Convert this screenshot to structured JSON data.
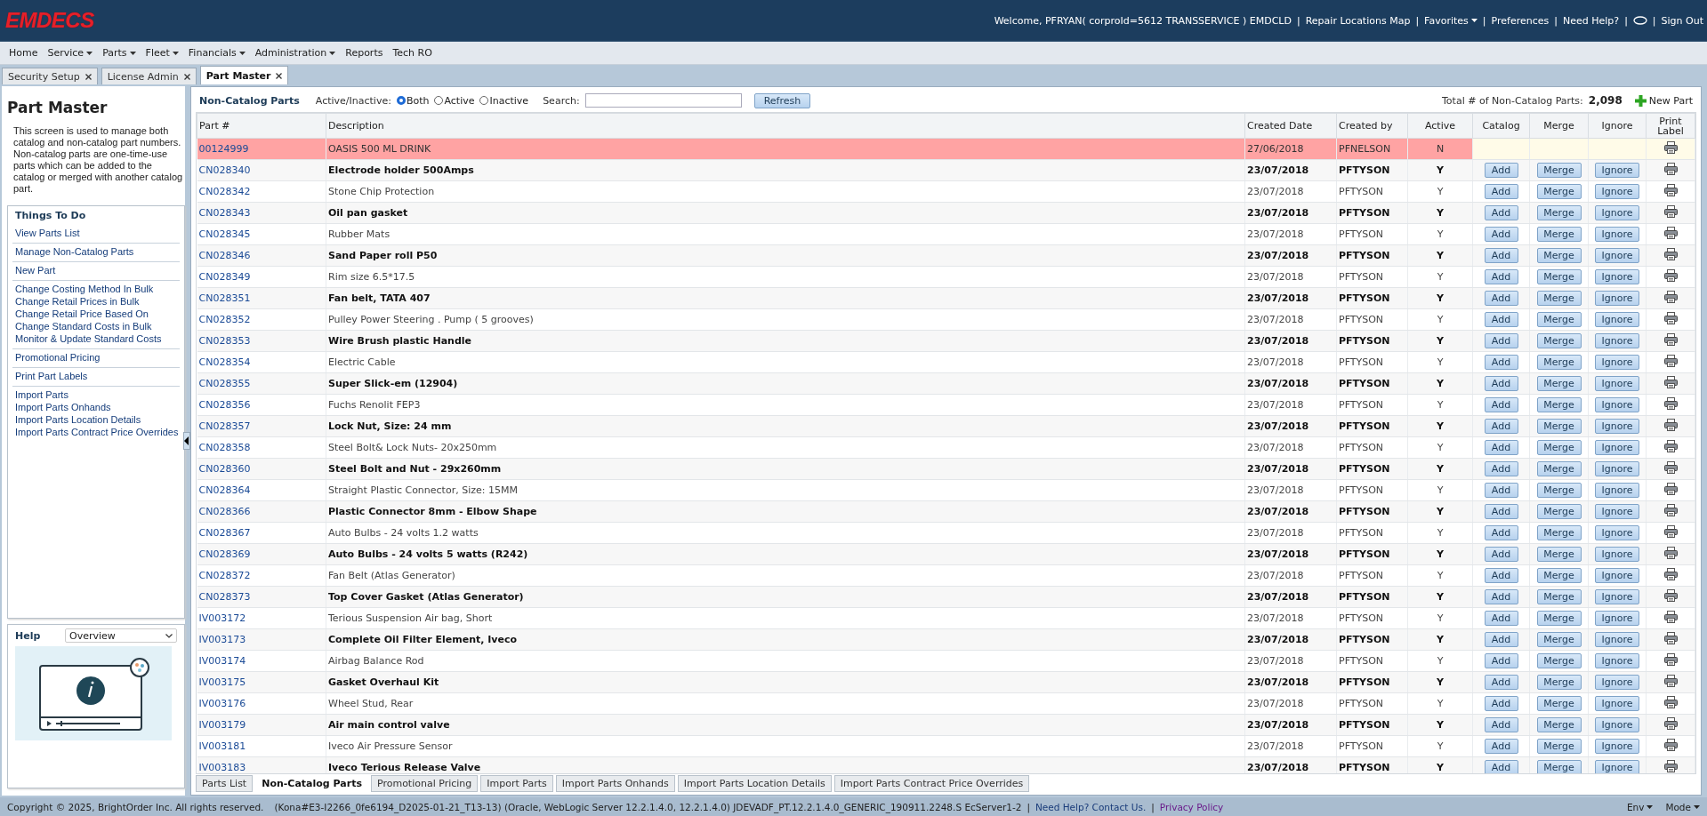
{
  "header": {
    "logo": "EMDECS",
    "items": [
      {
        "kind": "text",
        "text": "Welcome, PFRYAN( corproId=5612  TRANSSERVICE ) EMDCLD"
      },
      {
        "kind": "sep",
        "text": "|"
      },
      {
        "kind": "link",
        "text": "Repair Locations Map"
      },
      {
        "kind": "sep",
        "text": "|"
      },
      {
        "kind": "menu",
        "text": "Favorites"
      },
      {
        "kind": "sep",
        "text": "|"
      },
      {
        "kind": "link",
        "text": "Preferences"
      },
      {
        "kind": "sep",
        "text": "|"
      },
      {
        "kind": "link",
        "text": "Need Help?"
      },
      {
        "kind": "sep",
        "text": "|"
      },
      {
        "kind": "icon"
      },
      {
        "kind": "sep",
        "text": "|"
      },
      {
        "kind": "link",
        "text": "Sign Out"
      }
    ]
  },
  "menu": [
    {
      "label": "Home",
      "dropdown": false
    },
    {
      "label": "Service",
      "dropdown": true
    },
    {
      "label": "Parts",
      "dropdown": true
    },
    {
      "label": "Fleet",
      "dropdown": true
    },
    {
      "label": "Financials",
      "dropdown": true
    },
    {
      "label": "Administration",
      "dropdown": true
    },
    {
      "label": "Reports",
      "dropdown": false
    },
    {
      "label": "Tech RO",
      "dropdown": false
    }
  ],
  "tabs": [
    {
      "label": "Security Setup",
      "selected": false
    },
    {
      "label": "License Admin",
      "selected": false
    },
    {
      "label": "Part Master",
      "selected": true
    }
  ],
  "sidebar": {
    "title": "Part Master",
    "description": "This screen is used to manage both catalog and non-catalog part numbers. Non-catalog parts are one-time-use parts which can be added to the catalog or merged with another catalog part.",
    "todo_title": "Things To Do",
    "groups": [
      [
        "View Parts List"
      ],
      [
        "Manage Non-Catalog Parts"
      ],
      [
        "New Part"
      ],
      [
        "Change Costing Method In Bulk",
        "Change Retail Prices in Bulk",
        "Change Retail Price Based On",
        "Change Standard Costs in Bulk",
        "Monitor & Update Standard Costs"
      ],
      [
        "Promotional Pricing"
      ],
      [
        "Print Part Labels"
      ],
      [
        "Import Parts",
        "Import Parts Onhands",
        "Import Parts Location Details",
        "Import Parts Contract Price Overrides"
      ]
    ],
    "help": {
      "title": "Help",
      "select": "Overview"
    }
  },
  "toolbar": {
    "title": "Non-Catalog Parts",
    "filter_label": "Active/Inactive:",
    "radios": [
      {
        "label": "Both",
        "selected": true
      },
      {
        "label": "Active",
        "selected": false
      },
      {
        "label": "Inactive",
        "selected": false
      }
    ],
    "search_label": "Search:",
    "refresh": "Refresh",
    "total_label": "Total # of Non-Catalog Parts:",
    "total_value": "2,098",
    "new_part": "New Part"
  },
  "table": {
    "columns": [
      "Part #",
      "Description",
      "Created Date",
      "Created by",
      "Active",
      "Catalog",
      "Merge",
      "Ignore",
      "Print Label"
    ],
    "rows": [
      {
        "part": "00124999",
        "description": "OASIS 500 ML DRINK",
        "created": "27/06/2018",
        "by": "PFNELSON",
        "active": "N",
        "flagged": true
      },
      {
        "part": "CN028340",
        "description": "Electrode holder 500Amps",
        "created": "23/07/2018",
        "by": "PFTYSON",
        "active": "Y",
        "flagged": false,
        "catalog": "Add",
        "merge": "Merge",
        "ignore": "Ignore"
      },
      {
        "part": "CN028342",
        "description": "Stone Chip Protection",
        "created": "23/07/2018",
        "by": "PFTYSON",
        "active": "Y",
        "flagged": false,
        "catalog": "Add",
        "merge": "Merge",
        "ignore": "Ignore"
      },
      {
        "part": "CN028343",
        "description": "Oil pan gasket",
        "created": "23/07/2018",
        "by": "PFTYSON",
        "active": "Y",
        "flagged": false,
        "catalog": "Add",
        "merge": "Merge",
        "ignore": "Ignore"
      },
      {
        "part": "CN028345",
        "description": "Rubber Mats",
        "created": "23/07/2018",
        "by": "PFTYSON",
        "active": "Y",
        "flagged": false,
        "catalog": "Add",
        "merge": "Merge",
        "ignore": "Ignore"
      },
      {
        "part": "CN028346",
        "description": "Sand Paper roll P50",
        "created": "23/07/2018",
        "by": "PFTYSON",
        "active": "Y",
        "flagged": false,
        "catalog": "Add",
        "merge": "Merge",
        "ignore": "Ignore"
      },
      {
        "part": "CN028349",
        "description": "Rim size 6.5*17.5",
        "created": "23/07/2018",
        "by": "PFTYSON",
        "active": "Y",
        "flagged": false,
        "catalog": "Add",
        "merge": "Merge",
        "ignore": "Ignore"
      },
      {
        "part": "CN028351",
        "description": "Fan belt, TATA 407",
        "created": "23/07/2018",
        "by": "PFTYSON",
        "active": "Y",
        "flagged": false,
        "catalog": "Add",
        "merge": "Merge",
        "ignore": "Ignore"
      },
      {
        "part": "CN028352",
        "description": "Pulley Power Steering . Pump ( 5 grooves)",
        "created": "23/07/2018",
        "by": "PFTYSON",
        "active": "Y",
        "flagged": false,
        "catalog": "Add",
        "merge": "Merge",
        "ignore": "Ignore"
      },
      {
        "part": "CN028353",
        "description": "Wire Brush plastic Handle",
        "created": "23/07/2018",
        "by": "PFTYSON",
        "active": "Y",
        "flagged": false,
        "catalog": "Add",
        "merge": "Merge",
        "ignore": "Ignore"
      },
      {
        "part": "CN028354",
        "description": "Electric Cable",
        "created": "23/07/2018",
        "by": "PFTYSON",
        "active": "Y",
        "flagged": false,
        "catalog": "Add",
        "merge": "Merge",
        "ignore": "Ignore"
      },
      {
        "part": "CN028355",
        "description": "Super Slick-em (12904)",
        "created": "23/07/2018",
        "by": "PFTYSON",
        "active": "Y",
        "flagged": false,
        "catalog": "Add",
        "merge": "Merge",
        "ignore": "Ignore"
      },
      {
        "part": "CN028356",
        "description": "Fuchs Renolit FEP3",
        "created": "23/07/2018",
        "by": "PFTYSON",
        "active": "Y",
        "flagged": false,
        "catalog": "Add",
        "merge": "Merge",
        "ignore": "Ignore"
      },
      {
        "part": "CN028357",
        "description": "Lock Nut, Size: 24 mm",
        "created": "23/07/2018",
        "by": "PFTYSON",
        "active": "Y",
        "flagged": false,
        "catalog": "Add",
        "merge": "Merge",
        "ignore": "Ignore"
      },
      {
        "part": "CN028358",
        "description": "Steel Bolt& Lock Nuts- 20x250mm",
        "created": "23/07/2018",
        "by": "PFTYSON",
        "active": "Y",
        "flagged": false,
        "catalog": "Add",
        "merge": "Merge",
        "ignore": "Ignore"
      },
      {
        "part": "CN028360",
        "description": "Steel Bolt and Nut - 29x260mm",
        "created": "23/07/2018",
        "by": "PFTYSON",
        "active": "Y",
        "flagged": false,
        "catalog": "Add",
        "merge": "Merge",
        "ignore": "Ignore"
      },
      {
        "part": "CN028364",
        "description": "Straight Plastic Connector, Size: 15MM",
        "created": "23/07/2018",
        "by": "PFTYSON",
        "active": "Y",
        "flagged": false,
        "catalog": "Add",
        "merge": "Merge",
        "ignore": "Ignore"
      },
      {
        "part": "CN028366",
        "description": "Plastic Connector 8mm - Elbow Shape",
        "created": "23/07/2018",
        "by": "PFTYSON",
        "active": "Y",
        "flagged": false,
        "catalog": "Add",
        "merge": "Merge",
        "ignore": "Ignore"
      },
      {
        "part": "CN028367",
        "description": "Auto Bulbs - 24 volts 1.2 watts",
        "created": "23/07/2018",
        "by": "PFTYSON",
        "active": "Y",
        "flagged": false,
        "catalog": "Add",
        "merge": "Merge",
        "ignore": "Ignore"
      },
      {
        "part": "CN028369",
        "description": "Auto Bulbs - 24 volts 5 watts (R242)",
        "created": "23/07/2018",
        "by": "PFTYSON",
        "active": "Y",
        "flagged": false,
        "catalog": "Add",
        "merge": "Merge",
        "ignore": "Ignore"
      },
      {
        "part": "CN028372",
        "description": "Fan Belt (Atlas Generator)",
        "created": "23/07/2018",
        "by": "PFTYSON",
        "active": "Y",
        "flagged": false,
        "catalog": "Add",
        "merge": "Merge",
        "ignore": "Ignore"
      },
      {
        "part": "CN028373",
        "description": "Top Cover Gasket (Atlas Generator)",
        "created": "23/07/2018",
        "by": "PFTYSON",
        "active": "Y",
        "flagged": false,
        "catalog": "Add",
        "merge": "Merge",
        "ignore": "Ignore"
      },
      {
        "part": "IV003172",
        "description": "Terious Suspension Air bag, Short",
        "created": "23/07/2018",
        "by": "PFTYSON",
        "active": "Y",
        "flagged": false,
        "catalog": "Add",
        "merge": "Merge",
        "ignore": "Ignore"
      },
      {
        "part": "IV003173",
        "description": "Complete Oil Filter Element, Iveco",
        "created": "23/07/2018",
        "by": "PFTYSON",
        "active": "Y",
        "flagged": false,
        "catalog": "Add",
        "merge": "Merge",
        "ignore": "Ignore"
      },
      {
        "part": "IV003174",
        "description": "Airbag Balance Rod",
        "created": "23/07/2018",
        "by": "PFTYSON",
        "active": "Y",
        "flagged": false,
        "catalog": "Add",
        "merge": "Merge",
        "ignore": "Ignore"
      },
      {
        "part": "IV003175",
        "description": "Gasket Overhaul Kit",
        "created": "23/07/2018",
        "by": "PFTYSON",
        "active": "Y",
        "flagged": false,
        "catalog": "Add",
        "merge": "Merge",
        "ignore": "Ignore"
      },
      {
        "part": "IV003176",
        "description": "Wheel Stud, Rear",
        "created": "23/07/2018",
        "by": "PFTYSON",
        "active": "Y",
        "flagged": false,
        "catalog": "Add",
        "merge": "Merge",
        "ignore": "Ignore"
      },
      {
        "part": "IV003179",
        "description": "Air main control valve",
        "created": "23/07/2018",
        "by": "PFTYSON",
        "active": "Y",
        "flagged": false,
        "catalog": "Add",
        "merge": "Merge",
        "ignore": "Ignore"
      },
      {
        "part": "IV003181",
        "description": "Iveco Air Pressure Sensor",
        "created": "23/07/2018",
        "by": "PFTYSON",
        "active": "Y",
        "flagged": false,
        "catalog": "Add",
        "merge": "Merge",
        "ignore": "Ignore"
      },
      {
        "part": "IV003183",
        "description": "Iveco Terious Release Valve",
        "created": "23/07/2018",
        "by": "PFTYSON",
        "active": "Y",
        "flagged": false,
        "catalog": "Add",
        "merge": "Merge",
        "ignore": "Ignore"
      }
    ]
  },
  "bottom_tabs": [
    {
      "label": "Parts List",
      "selected": false
    },
    {
      "label": "Non-Catalog Parts",
      "selected": true
    },
    {
      "label": "Promotional Pricing",
      "selected": false
    },
    {
      "label": "Import Parts",
      "selected": false
    },
    {
      "label": "Import Parts Onhands",
      "selected": false
    },
    {
      "label": "Import Parts Location Details",
      "selected": false
    },
    {
      "label": "Import Parts Contract Price Overrides",
      "selected": false
    }
  ],
  "footer": {
    "copyright": "Copyright © 2025, BrightOrder Inc. All rights reserved.",
    "version": "(Kona#E3-I2266_0fe6194_D2025-01-21_T13-13) (Oracle, WebLogic Server 12.2.1.4.0, 12.2.1.4.0) JDEVADF_PT.12.2.1.4.0_GENERIC_190911.2248.S EcServer1-2",
    "links": [
      {
        "kind": "sep",
        "text": "|"
      },
      {
        "kind": "link",
        "text": "Need Help? Contact Us."
      },
      {
        "kind": "sep",
        "text": "|"
      },
      {
        "kind": "privacy",
        "text": "Privacy Policy"
      }
    ],
    "menus": [
      "Env",
      "Mode"
    ]
  }
}
